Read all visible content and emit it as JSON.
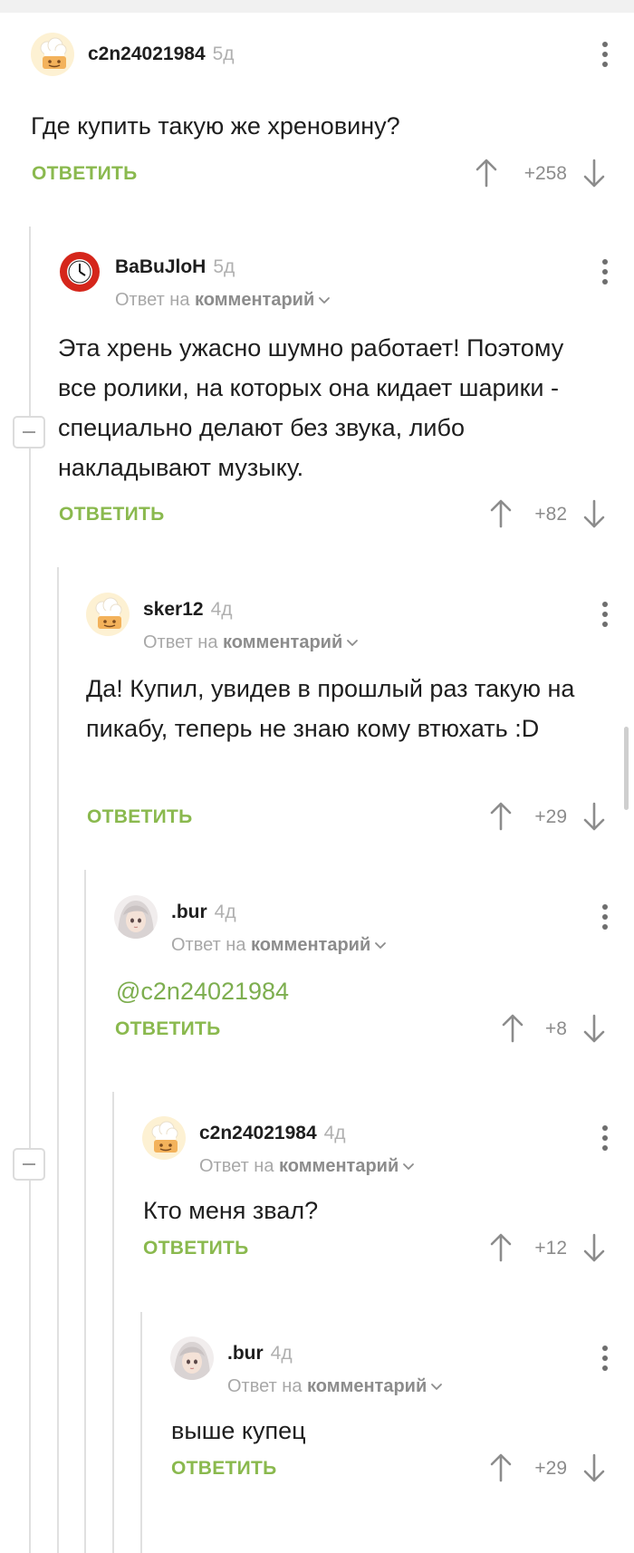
{
  "comments": [
    {
      "author": "c2n24021984",
      "time": "5д",
      "text": "Где купить такую же хреновину?",
      "reply": "ОТВЕТИТЬ",
      "score": "+258",
      "avatar": "cook-avatar"
    },
    {
      "author": "BaBuJloH",
      "time": "5д",
      "reply_to_prefix": "Ответ на",
      "reply_to_link": "комментарий",
      "text": "Эта хрень ужасно шумно работает! Поэтому все ролики, на которых она кидает шарики - специально делают без звука, либо накладывают музыку.",
      "reply": "ОТВЕТИТЬ",
      "score": "+82",
      "avatar": "clock-avatar"
    },
    {
      "author": "sker12",
      "time": "4д",
      "reply_to_prefix": "Ответ на",
      "reply_to_link": "комментарий",
      "text": "Да! Купил, увидев в прошлый раз такую на пикабу, теперь не знаю кому втюхать :D",
      "reply": "ОТВЕТИТЬ",
      "score": "+29",
      "avatar": "cook-avatar"
    },
    {
      "author": ".bur",
      "time": "4д",
      "reply_to_prefix": "Ответ на",
      "reply_to_link": "комментарий",
      "text": "@c2n24021984",
      "reply": "ОТВЕТИТЬ",
      "score": "+8",
      "avatar": "anime-girl-avatar"
    },
    {
      "author": "c2n24021984",
      "time": "4д",
      "reply_to_prefix": "Ответ на",
      "reply_to_link": "комментарий",
      "text": "Кто меня звал?",
      "reply": "ОТВЕТИТЬ",
      "score": "+12",
      "avatar": "cook-avatar"
    },
    {
      "author": ".bur",
      "time": "4д",
      "reply_to_prefix": "Ответ на",
      "reply_to_link": "комментарий",
      "text": "выше купец",
      "reply": "ОТВЕТИТЬ",
      "score": "+29",
      "avatar": "anime-girl-avatar"
    }
  ],
  "colors": {
    "accent": "#8ab94e",
    "mention": "#7dae4f",
    "meta": "#a8a8a8",
    "thread_line": "#e0e0e0"
  }
}
